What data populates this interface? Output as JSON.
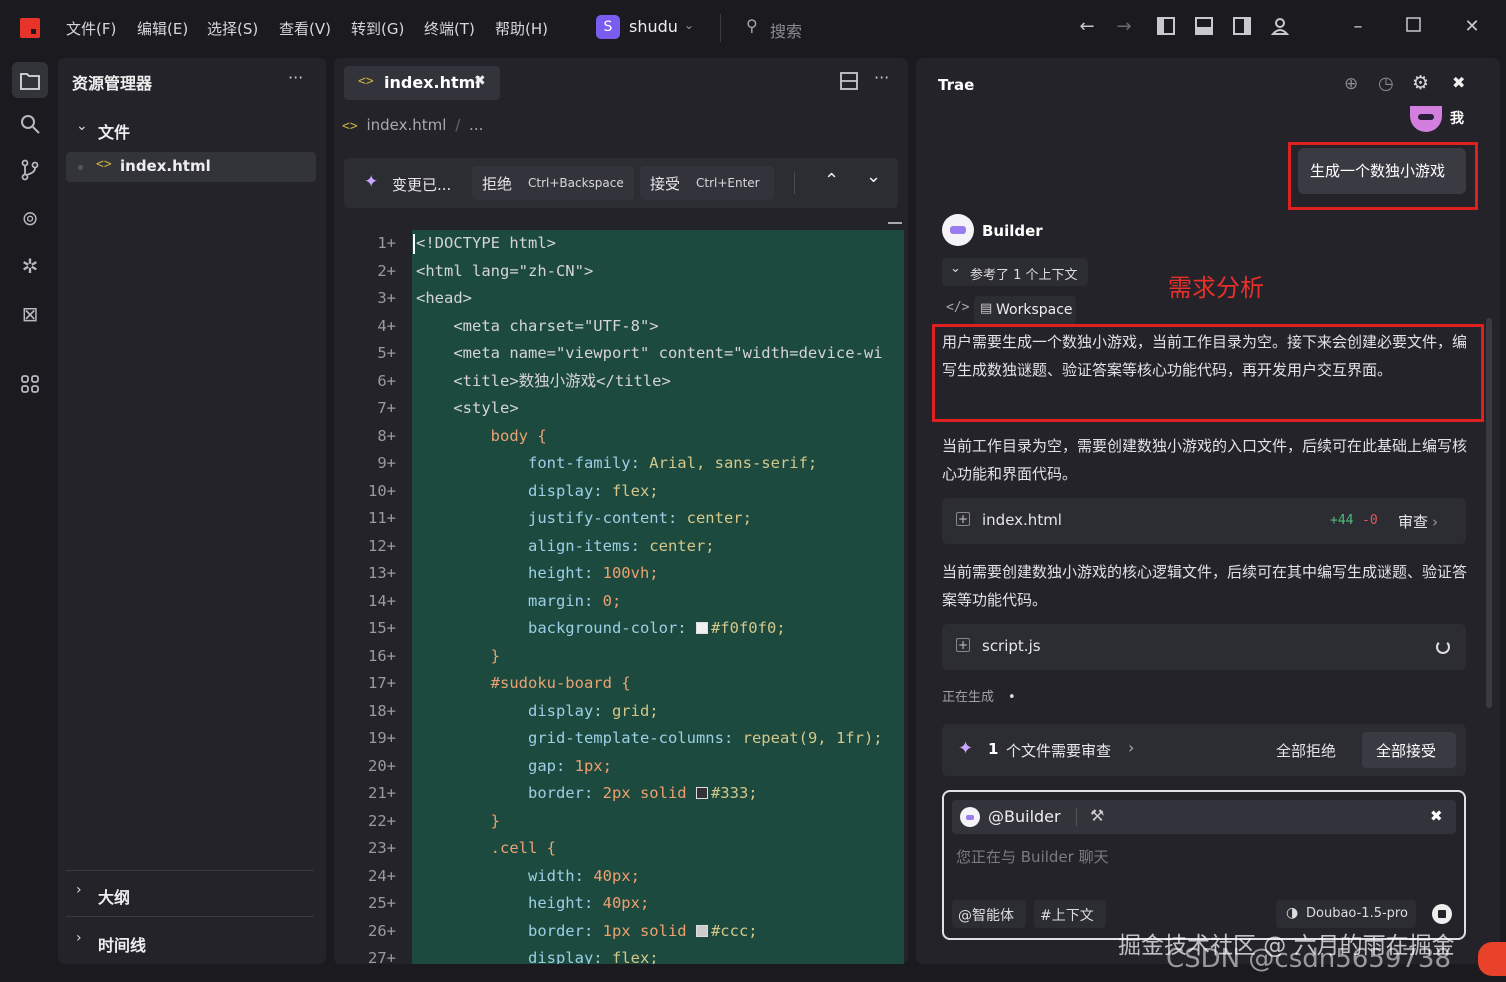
{
  "titlebar": {
    "menus": [
      "文件(F)",
      "编辑(E)",
      "选择(S)",
      "查看(V)",
      "转到(G)",
      "终端(T)",
      "帮助(H)"
    ],
    "project_initial": "S",
    "project_name": "shudu",
    "search_placeholder": "搜索",
    "brand_color": "#e8332a"
  },
  "explorer": {
    "title": "资源管理器",
    "more": "···",
    "folder": "文件",
    "file": "index.html",
    "outline": "大纲",
    "timeline": "时间线"
  },
  "editor": {
    "tab": "index.html",
    "tab_close": "✖",
    "breadcrumb_file": "index.html",
    "breadcrumb_sep": "/",
    "breadcrumb_more": "...",
    "changes_label": "变更已...",
    "reject_label": "拒绝",
    "reject_key": "Ctrl+Backspace",
    "accept_label": "接受",
    "accept_key": "Ctrl+Enter",
    "added_bg": "#1d4a3e"
  },
  "code_lines": [
    {
      "n": "1+",
      "tokens": [
        [
          "t",
          "<!DOCTYPE html>"
        ]
      ]
    },
    {
      "n": "2+",
      "tokens": [
        [
          "t",
          "<html lang=\"zh-CN\">"
        ]
      ]
    },
    {
      "n": "3+",
      "tokens": [
        [
          "t",
          "<head>"
        ]
      ]
    },
    {
      "n": "4+",
      "tokens": [
        [
          "t",
          "    <meta charset=\"UTF-8\">"
        ]
      ]
    },
    {
      "n": "5+",
      "tokens": [
        [
          "t",
          "    <meta name=\"viewport\" content=\"width=device-wi"
        ]
      ]
    },
    {
      "n": "6+",
      "tokens": [
        [
          "t",
          "    <title>数独小游戏</title>"
        ]
      ]
    },
    {
      "n": "7+",
      "tokens": [
        [
          "t",
          "    <style>"
        ]
      ]
    },
    {
      "n": "8+",
      "tokens": [
        [
          "k",
          "        body {"
        ]
      ]
    },
    {
      "n": "9+",
      "tokens": [
        [
          "p",
          "            font-family: "
        ],
        [
          "s",
          "Arial, sans-serif;"
        ]
      ]
    },
    {
      "n": "10+",
      "tokens": [
        [
          "p",
          "            display: "
        ],
        [
          "s",
          "flex;"
        ]
      ]
    },
    {
      "n": "11+",
      "tokens": [
        [
          "p",
          "            justify-content: "
        ],
        [
          "s",
          "center;"
        ]
      ]
    },
    {
      "n": "12+",
      "tokens": [
        [
          "p",
          "            align-items: "
        ],
        [
          "s",
          "center;"
        ]
      ]
    },
    {
      "n": "13+",
      "tokens": [
        [
          "p",
          "            height: "
        ],
        [
          "n",
          "100vh;"
        ]
      ]
    },
    {
      "n": "14+",
      "tokens": [
        [
          "p",
          "            margin: "
        ],
        [
          "n",
          "0;"
        ]
      ]
    },
    {
      "n": "15+",
      "tokens": [
        [
          "p",
          "            background-color: "
        ],
        [
          "sw",
          "#f0f0f0"
        ],
        [
          "s",
          "#f0f0f0;"
        ]
      ]
    },
    {
      "n": "16+",
      "tokens": [
        [
          "k",
          "        }"
        ]
      ]
    },
    {
      "n": "17+",
      "tokens": [
        [
          "k",
          "        #sudoku-board {"
        ]
      ]
    },
    {
      "n": "18+",
      "tokens": [
        [
          "p",
          "            display: "
        ],
        [
          "s",
          "grid;"
        ]
      ]
    },
    {
      "n": "19+",
      "tokens": [
        [
          "p",
          "            grid-template-columns: "
        ],
        [
          "s",
          "repeat(9, 1fr);"
        ]
      ]
    },
    {
      "n": "20+",
      "tokens": [
        [
          "p",
          "            gap: "
        ],
        [
          "n",
          "1px;"
        ]
      ]
    },
    {
      "n": "21+",
      "tokens": [
        [
          "p",
          "            border: "
        ],
        [
          "n",
          "2px solid "
        ],
        [
          "sw",
          "#333"
        ],
        [
          "s",
          "#333;"
        ]
      ]
    },
    {
      "n": "22+",
      "tokens": [
        [
          "k",
          "        }"
        ]
      ]
    },
    {
      "n": "23+",
      "tokens": [
        [
          "k",
          "        .cell {"
        ]
      ]
    },
    {
      "n": "24+",
      "tokens": [
        [
          "p",
          "            width: "
        ],
        [
          "n",
          "40px;"
        ]
      ]
    },
    {
      "n": "25+",
      "tokens": [
        [
          "p",
          "            height: "
        ],
        [
          "n",
          "40px;"
        ]
      ]
    },
    {
      "n": "26+",
      "tokens": [
        [
          "p",
          "            border: "
        ],
        [
          "n",
          "1px solid "
        ],
        [
          "sw",
          "#ccc"
        ],
        [
          "s",
          "#ccc;"
        ]
      ]
    },
    {
      "n": "27+",
      "tokens": [
        [
          "p",
          "            display: "
        ],
        [
          "s",
          "flex;"
        ]
      ]
    }
  ],
  "chat": {
    "title": "Trae",
    "user_label": "我",
    "user_message": "生成一个数独小游戏",
    "agent_name": "Builder",
    "context_label": "参考了 1 个上下文",
    "workspace_label": "Workspace",
    "annotation": "需求分析",
    "analysis": "用户需要生成一个数独小游戏，当前工作目录为空。接下来会创建必要文件，编写生成数独谜题、验证答案等核心功能代码，再开发用户交互界面。",
    "para1": "当前工作目录为空，需要创建数独小游戏的入口文件，后续可在此基础上编写核心功能和界面代码。",
    "file1": "index.html",
    "file1_add": "+44",
    "file1_del": "-0",
    "review_label": "审查",
    "para2": "当前需要创建数独小游戏的核心逻辑文件，后续可在其中编写生成谜题、验证答案等功能代码。",
    "file2": "script.js",
    "generating": "正在生成",
    "generating_dot": "•",
    "pending_count": "1",
    "pending_text": "个文件需要审查",
    "reject_all": "全部拒绝",
    "accept_all": "全部接受",
    "mention": "@Builder",
    "input_placeholder": "您正在与 Builder 聊天",
    "agent_chip": "@智能体",
    "context_chip": "#上下文",
    "model": "Doubao-1.5-pro"
  },
  "watermark": {
    "line1": "掘金技术社区 @ 六月的雨在掘金",
    "line2": "CSDN @csdn5659738"
  }
}
